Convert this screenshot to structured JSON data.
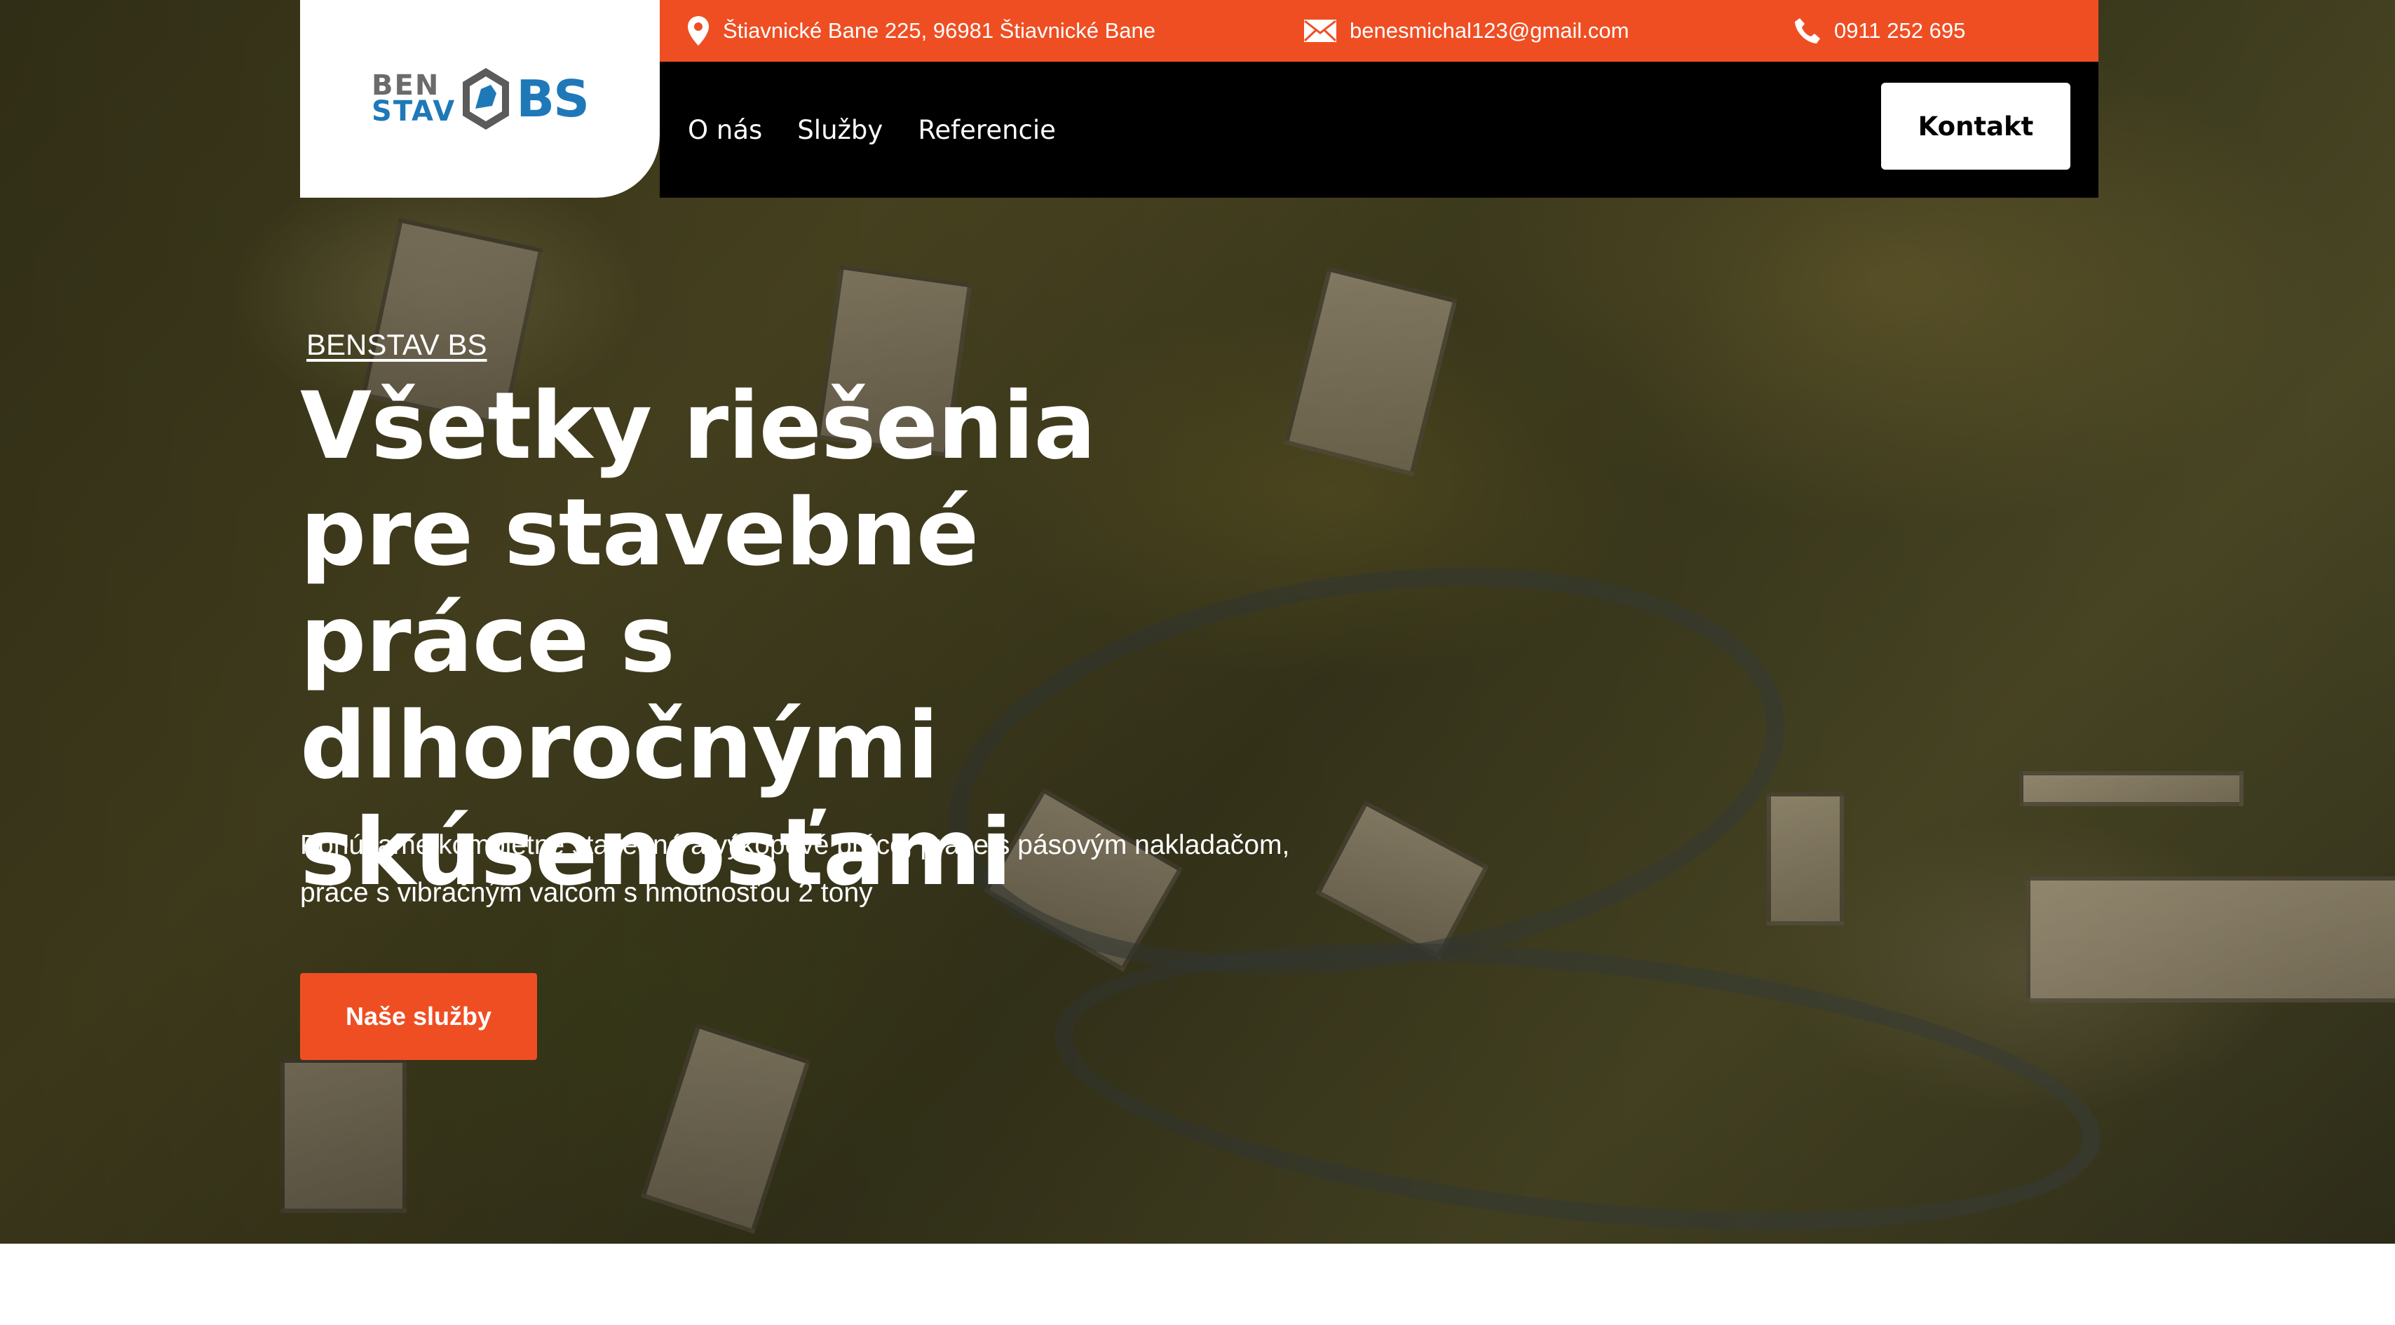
{
  "brand": {
    "logo_line1": "BEN",
    "logo_line2": "STAV",
    "logo_mark": "BS",
    "primary_color": "#ef4e23",
    "logo_blue": "#1f78b8"
  },
  "topbar": {
    "address": "Štiavnické Bane 225, 96981 Štiavnické Bane",
    "address_icon": "location-pin-icon",
    "email": "benesmichal123@gmail.com",
    "email_icon": "envelope-icon",
    "phone": "0911 252 695",
    "phone_icon": "phone-icon"
  },
  "nav": {
    "items": [
      {
        "label": "O nás"
      },
      {
        "label": "Služby"
      },
      {
        "label": "Referencie"
      }
    ],
    "contact_label": "Kontakt"
  },
  "hero": {
    "eyebrow": "BENSTAV BS",
    "headline": "Všetky riešenia pre stavebné práce s dlhoročnými skúsenosťami",
    "subtext": "Ponúkame kompletné stavebné a výkopové práce, práce s pásovým nakladačom, práce s vibračným valcom s hmotnosťou 2 tony",
    "cta_label": "Naše služby"
  }
}
